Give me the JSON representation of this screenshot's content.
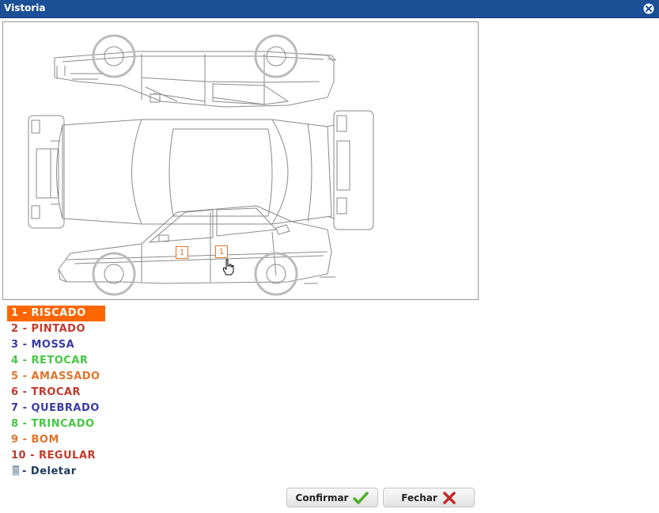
{
  "window": {
    "title": "Vistoria",
    "close_icon": "close-circle-icon"
  },
  "markers": [
    {
      "label": "1"
    },
    {
      "label": "1"
    }
  ],
  "legend": [
    {
      "label": "1 - RISCADO",
      "color": "#ff6600",
      "selected": true
    },
    {
      "label": "2 - PINTADO",
      "color": "#c0392b"
    },
    {
      "label": "3 - MOSSA",
      "color": "#3b3ba8"
    },
    {
      "label": "4 - RETOCAR",
      "color": "#45c745"
    },
    {
      "label": "5 - AMASSADO",
      "color": "#e0742b"
    },
    {
      "label": "6 - TROCAR",
      "color": "#c0392b"
    },
    {
      "label": "7 - QUEBRADO",
      "color": "#3b3ba8"
    },
    {
      "label": "8 - TRINCADO",
      "color": "#45c745"
    },
    {
      "label": "9 - BOM",
      "color": "#e0742b"
    },
    {
      "label": "10 - REGULAR",
      "color": "#c0392b"
    },
    {
      "label": "- Deletar",
      "color": "#1a3a5a",
      "icon": "trash-icon"
    }
  ],
  "buttons": {
    "confirm_label": "Confirmar",
    "confirm_icon": "checkmark-icon",
    "close_label": "Fechar",
    "close_icon": "x-icon"
  }
}
